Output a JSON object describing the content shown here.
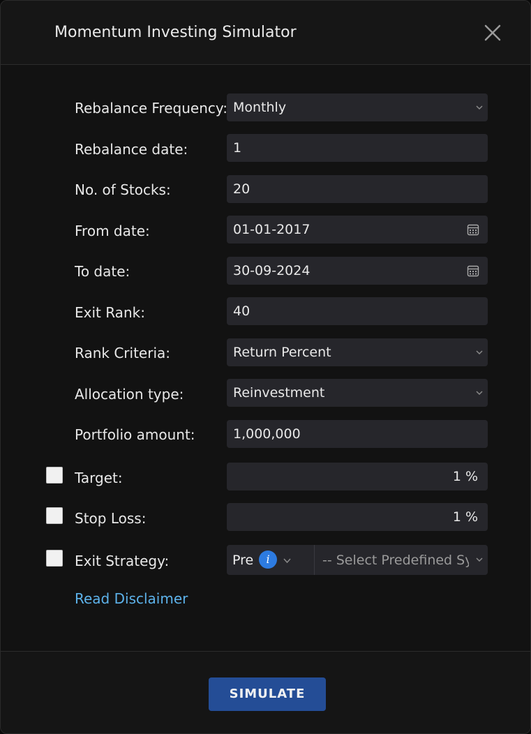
{
  "header": {
    "title": "Momentum Investing Simulator"
  },
  "form": {
    "rebalance_frequency": {
      "label": "Rebalance Frequency:",
      "value": "Monthly"
    },
    "rebalance_date": {
      "label": "Rebalance date:",
      "value": "1"
    },
    "num_stocks": {
      "label": "No. of Stocks:",
      "value": "20"
    },
    "from_date": {
      "label": "From date:",
      "value": "01-01-2017"
    },
    "to_date": {
      "label": "To date:",
      "value": "30-09-2024"
    },
    "exit_rank": {
      "label": "Exit Rank:",
      "value": "40"
    },
    "rank_criteria": {
      "label": "Rank Criteria:",
      "value": "Return Percent"
    },
    "allocation_type": {
      "label": "Allocation type:",
      "value": "Reinvestment"
    },
    "portfolio_amount": {
      "label": "Portfolio amount:",
      "value": "1,000,000"
    },
    "target": {
      "label": "Target:",
      "value": "1 %",
      "checked": false
    },
    "stop_loss": {
      "label": "Stop Loss:",
      "value": "1 %",
      "checked": false
    },
    "exit_strategy": {
      "label": "Exit Strategy:",
      "checked": false,
      "mode_value": "Pre",
      "info_glyph": "i",
      "select_placeholder": "-- Select Predefined System --"
    },
    "disclaimer_link": "Read Disclaimer"
  },
  "footer": {
    "simulate_label": "SIMULATE"
  },
  "colors": {
    "background": "#121212",
    "field": "#26262b",
    "accent_button": "#244d96",
    "link": "#5db2ea",
    "info": "#2d7be0"
  },
  "icons": {
    "close": "close-icon",
    "chevron": "chevron-down-icon",
    "calendar": "calendar-icon",
    "info": "info-icon"
  }
}
